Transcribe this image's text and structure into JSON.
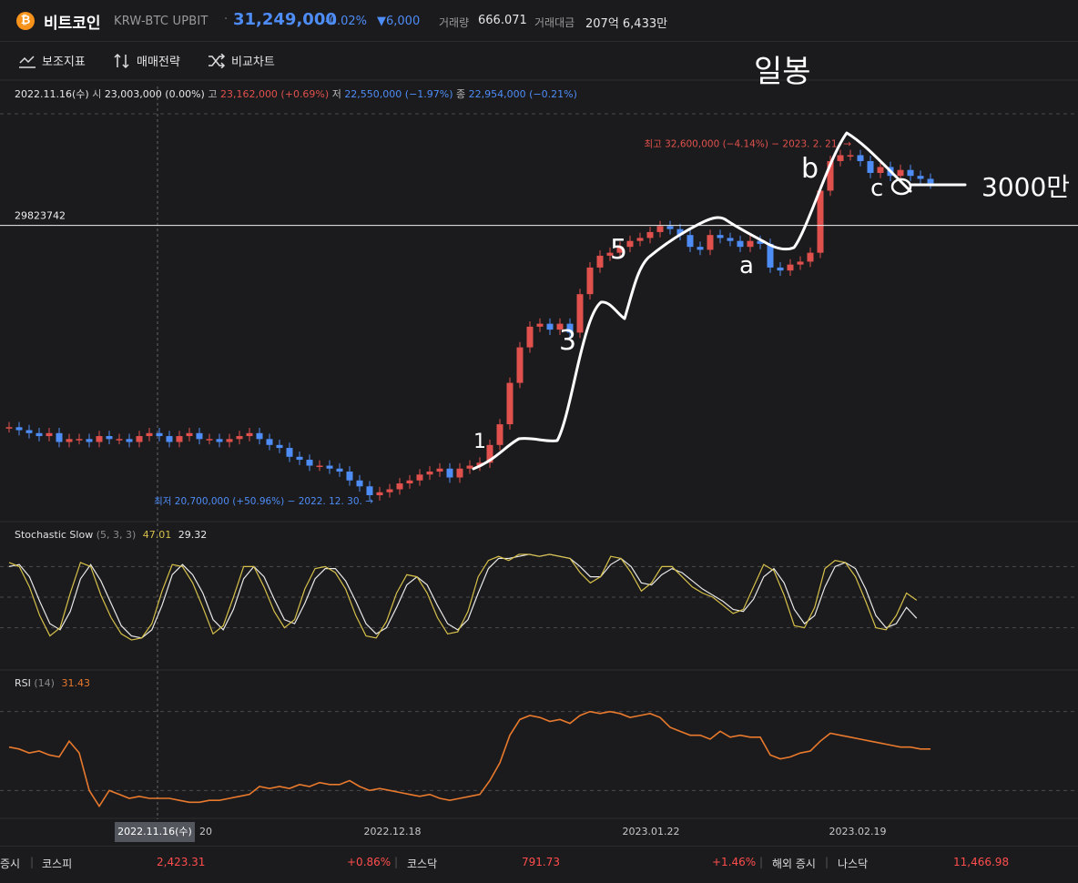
{
  "header": {
    "coin_icon": "bitcoin-icon",
    "coin_symbol": "₿",
    "name": "비트코인",
    "pair": "KRW-BTC  UPBIT",
    "separator": "·",
    "price": "31,249,000",
    "change_pct": "-0.02%",
    "change_value": "▼6,000",
    "volume_label": "거래량",
    "volume": "666.071",
    "amount_label": "거래대금",
    "amount": "207억 6,433만"
  },
  "toolbar": {
    "indicators": "보조지표",
    "strategy": "매매전략",
    "compare": "비교차트"
  },
  "ohlc": {
    "date": "2022.11.16(수)",
    "open_label": "시",
    "open": "23,003,000 (0.00%)",
    "high_label": "고",
    "high": "23,162,000 (+0.69%)",
    "low_label": "저",
    "low": "22,550,000 (−1.97%)",
    "close_label": "종",
    "close": "22,954,000 (−0.21%)"
  },
  "indicators": {
    "stoch_name": "Stochastic Slow",
    "stoch_params": "(5, 3, 3)",
    "stoch_k": "47.01",
    "stoch_d": "29.32",
    "rsi_name": "RSI",
    "rsi_params": "(14)",
    "rsi_value": "31.43"
  },
  "chart_data": {
    "type": "candlestick",
    "timeframe": "daily",
    "ylim": [
      19900000,
      34000000
    ],
    "x_ticks": [
      {
        "index": 4,
        "label": "20"
      },
      {
        "index": 32,
        "label": "2022.12.18"
      },
      {
        "index": 67,
        "label": "2023.01.22"
      },
      {
        "index": 95,
        "label": "2023.02.19"
      }
    ],
    "crosshair": {
      "date": "2022.11.16(수)",
      "index": 0
    },
    "price_line": {
      "label": "29823742",
      "value": 29823742
    },
    "max_marker": "최고 32,600,000 (−4.14%) − 2023. 2. 21. →",
    "min_marker": "최저 20,700,000 (+50.96%) − 2022. 12. 30. →",
    "close": [
      23000000,
      22900000,
      22800000,
      22700000,
      22800000,
      22500000,
      22600000,
      22600000,
      22500000,
      22700000,
      22600000,
      22600000,
      22500000,
      22700000,
      22800000,
      22700000,
      22500000,
      22700000,
      22800000,
      22600000,
      22600000,
      22500000,
      22600000,
      22700000,
      22800000,
      22600000,
      22400000,
      22300000,
      22000000,
      21900000,
      21700000,
      21700000,
      21600000,
      21500000,
      21200000,
      21000000,
      20700000,
      20800000,
      20900000,
      21100000,
      21200000,
      21400000,
      21500000,
      21600000,
      21300000,
      21600000,
      21700000,
      21800000,
      22400000,
      23100000,
      24500000,
      25700000,
      26400000,
      26500000,
      26300000,
      26500000,
      26200000,
      27500000,
      28400000,
      28800000,
      28900000,
      29100000,
      29300000,
      29400000,
      29600000,
      29800000,
      29700000,
      29500000,
      29100000,
      29000000,
      29500000,
      29400000,
      29300000,
      29100000,
      29300000,
      29200000,
      28400000,
      28300000,
      28500000,
      28600000,
      28900000,
      31000000,
      32000000,
      32200000,
      32200000,
      32000000,
      31600000,
      31800000,
      31500000,
      31700000,
      31500000,
      31400000,
      31249000
    ],
    "rsi": {
      "series": [
        52,
        51,
        49,
        50,
        48,
        47,
        55,
        49,
        30,
        22,
        30,
        28,
        26,
        27,
        26,
        26,
        26,
        25,
        24,
        24,
        25,
        25,
        26,
        27,
        28,
        32,
        31,
        32,
        31,
        33,
        32,
        34,
        33,
        33,
        35,
        32,
        30,
        31,
        30,
        29,
        28,
        27,
        28,
        26,
        25,
        26,
        27,
        28,
        35,
        44,
        58,
        66,
        68,
        67,
        65,
        66,
        64,
        68,
        70,
        69,
        70,
        69,
        67,
        68,
        69,
        67,
        62,
        60,
        58,
        58,
        56,
        60,
        57,
        58,
        57,
        57,
        48,
        46,
        47,
        49,
        50,
        55,
        59,
        58,
        57,
        56,
        55,
        54,
        53,
        52,
        52,
        51,
        51
      ],
      "levels": [
        30,
        70
      ]
    },
    "stochastic": {
      "k": [
        84,
        80,
        60,
        32,
        12,
        20,
        54,
        84,
        80,
        52,
        30,
        14,
        8,
        10,
        24,
        56,
        82,
        80,
        64,
        40,
        14,
        22,
        50,
        80,
        80,
        60,
        36,
        20,
        28,
        58,
        78,
        80,
        74,
        58,
        32,
        12,
        10,
        26,
        54,
        72,
        70,
        54,
        30,
        14,
        16,
        36,
        70,
        86,
        90,
        86,
        92,
        92,
        90,
        92,
        90,
        88,
        74,
        64,
        70,
        90,
        88,
        74,
        56,
        64,
        80,
        80,
        70,
        60,
        54,
        50,
        42,
        34,
        38,
        60,
        82,
        76,
        52,
        22,
        20,
        40,
        78,
        86,
        84,
        70,
        46,
        20,
        18,
        32,
        54,
        47
      ],
      "d": [
        80,
        82,
        70,
        46,
        24,
        18,
        36,
        68,
        82,
        66,
        44,
        22,
        12,
        10,
        18,
        42,
        72,
        82,
        72,
        54,
        28,
        18,
        38,
        68,
        80,
        70,
        48,
        28,
        24,
        44,
        68,
        78,
        78,
        66,
        46,
        24,
        14,
        20,
        40,
        62,
        70,
        62,
        42,
        24,
        18,
        28,
        54,
        78,
        88,
        88,
        90,
        92,
        90,
        92,
        90,
        88,
        80,
        70,
        70,
        82,
        88,
        80,
        64,
        62,
        72,
        78,
        74,
        66,
        58,
        52,
        46,
        38,
        36,
        48,
        70,
        78,
        64,
        38,
        24,
        32,
        60,
        80,
        84,
        78,
        58,
        32,
        20,
        24,
        40,
        29.32
      ],
      "levels": [
        20,
        50,
        80
      ]
    },
    "annotations": [
      "일봉",
      "1",
      "3",
      "5",
      "a",
      "b",
      "c",
      "3000만"
    ]
  },
  "colors": {
    "up": "#e0504c",
    "down": "#4e8cf6",
    "stoch_k": "#d6c04a",
    "stoch_d": "#e8e8e8",
    "rsi": "#e8792d"
  },
  "footer": {
    "left_label": "증시",
    "kospi_label": "코스피",
    "kospi_value": "2,423.31",
    "kospi_change": "+0.86%",
    "kosdaq_label": "코스닥",
    "kosdaq_value": "791.73",
    "kosdaq_change": "+1.46%",
    "overseas_label": "해외 증시",
    "nasdaq_label": "나스닥",
    "nasdaq_value": "11,466.98"
  }
}
